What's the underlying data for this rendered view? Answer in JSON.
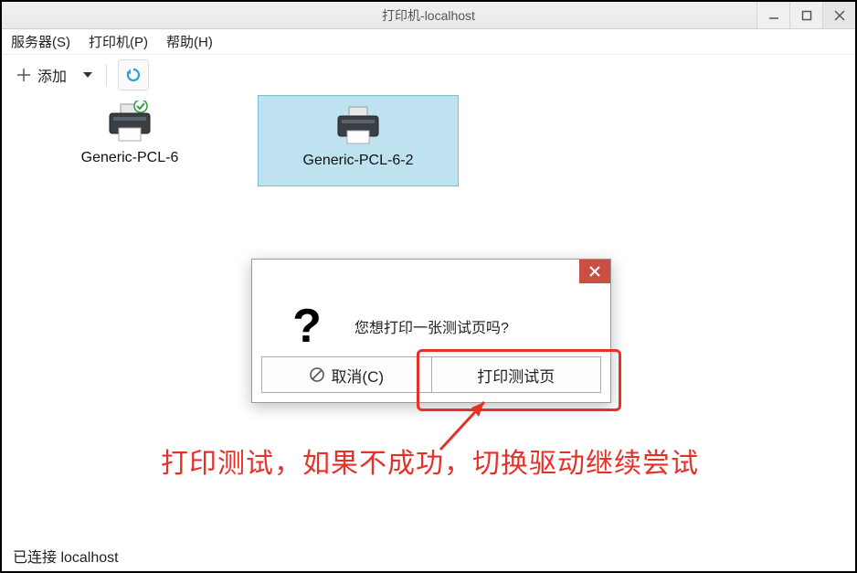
{
  "window": {
    "title": "打印机-localhost"
  },
  "menu": {
    "server": "服务器(S)",
    "printer": "打印机(P)",
    "help": "帮助(H)"
  },
  "toolbar": {
    "add_label": "添加"
  },
  "printers": {
    "p1": {
      "label": "Generic-PCL-6"
    },
    "p2": {
      "label": "Generic-PCL-6-2"
    }
  },
  "dialog": {
    "question_text": "您想打印一张测试页吗?",
    "cancel_label": "取消(C)",
    "print_label": "打印测试页"
  },
  "annotation": {
    "text": "打印测试，如果不成功，切换驱动继续尝试"
  },
  "status": {
    "text": "已连接 localhost"
  }
}
